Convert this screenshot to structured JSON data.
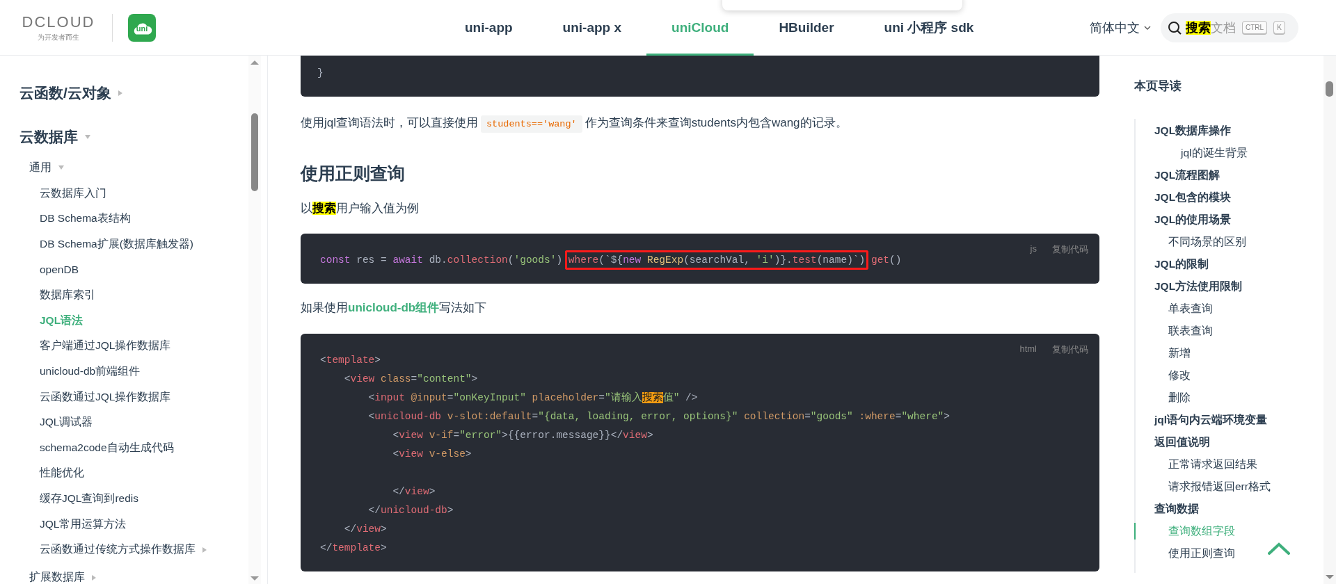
{
  "header": {
    "logo": {
      "wordmark": "DCLOUD",
      "tagline": "为开发者而生",
      "app_badge": "uni"
    },
    "nav": [
      {
        "label": "uni-app",
        "selected": false
      },
      {
        "label": "uni-app x",
        "selected": false
      },
      {
        "label": "uniCloud",
        "selected": true
      },
      {
        "label": "HBuilder",
        "selected": false
      },
      {
        "label": "uni 小程序 sdk",
        "selected": false
      }
    ],
    "language": "简体中文",
    "search": {
      "segments": [
        {
          "text": "搜索",
          "highlighted": true
        },
        {
          "text": "文档",
          "highlighted": false
        }
      ],
      "keys": [
        "CTRL",
        "K"
      ]
    }
  },
  "sidebar": {
    "items": [
      {
        "label": "云函数/云对象",
        "kind": "group",
        "expanded": false,
        "selected": false
      },
      {
        "label": "云数据库",
        "kind": "group",
        "expanded": true,
        "selected": false,
        "children": [
          {
            "label": "通用",
            "kind": "group",
            "expanded": true,
            "selected": false,
            "children": [
              {
                "label": "云数据库入门",
                "kind": "page",
                "selected": false
              },
              {
                "label": "DB Schema表结构",
                "kind": "page",
                "selected": false
              },
              {
                "label": "DB Schema扩展(数据库触发器)",
                "kind": "page",
                "selected": false
              },
              {
                "label": "openDB",
                "kind": "page",
                "selected": false
              },
              {
                "label": "数据库索引",
                "kind": "page",
                "selected": false
              },
              {
                "label": "JQL语法",
                "kind": "page",
                "selected": true
              },
              {
                "label": "客户端通过JQL操作数据库",
                "kind": "page",
                "selected": false
              },
              {
                "label": "unicloud-db前端组件",
                "kind": "page",
                "selected": false
              },
              {
                "label": "云函数通过JQL操作数据库",
                "kind": "page",
                "selected": false
              },
              {
                "label": "JQL调试器",
                "kind": "page",
                "selected": false
              },
              {
                "label": "schema2code自动生成代码",
                "kind": "page",
                "selected": false
              },
              {
                "label": "性能优化",
                "kind": "page",
                "selected": false
              },
              {
                "label": "缓存JQL查询到redis",
                "kind": "page",
                "selected": false
              },
              {
                "label": "JQL常用运算方法",
                "kind": "page",
                "selected": false
              },
              {
                "label": "云函数通过传统方式操作数据库",
                "kind": "group",
                "expanded": false,
                "selected": false
              }
            ]
          },
          {
            "label": "扩展数据库",
            "kind": "group",
            "expanded": false,
            "selected": false
          }
        ]
      }
    ]
  },
  "content": {
    "blocks": [
      {
        "kind": "code",
        "continued": true,
        "lines": [
          {
            "blank_before": false,
            "tokens": [
              {
                "kind": "punct",
                "text": "}"
              }
            ]
          }
        ]
      },
      {
        "kind": "paragraph",
        "segments": [
          {
            "kind": "text",
            "text": "使用jql查询语法时，可以直接使用"
          },
          {
            "kind": "code",
            "text": "students=='wang'"
          },
          {
            "kind": "text",
            "text": "作为查询条件来查询students内包含wang的记录。"
          }
        ]
      },
      {
        "kind": "heading",
        "text": "使用正则查询"
      },
      {
        "kind": "paragraph",
        "segments": [
          {
            "kind": "text",
            "text": "以"
          },
          {
            "kind": "mark",
            "text": "搜索"
          },
          {
            "kind": "text",
            "text": "用户输入值为例"
          }
        ]
      },
      {
        "kind": "code",
        "continued": false,
        "language": "js",
        "copy": "复制代码",
        "lines": [
          {
            "blank_before": false,
            "tokens": [
              {
                "kind": "kw",
                "text": "const",
                "boxed": false
              },
              {
                "kind": "punct",
                "text": " res = ",
                "boxed": false
              },
              {
                "kind": "kw",
                "text": "await",
                "boxed": false
              },
              {
                "kind": "punct",
                "text": " db.",
                "boxed": false
              },
              {
                "kind": "fn",
                "text": "collection",
                "boxed": false
              },
              {
                "kind": "punct",
                "text": "(",
                "boxed": false
              },
              {
                "kind": "str",
                "text": "'goods'",
                "boxed": false
              },
              {
                "kind": "punct",
                "text": ") ",
                "boxed": false
              },
              {
                "kind": "fn",
                "text": "where",
                "boxed": true
              },
              {
                "kind": "punct",
                "text": "(`${",
                "boxed": true
              },
              {
                "kind": "kw",
                "text": "new ",
                "boxed": true
              },
              {
                "kind": "cls",
                "text": "RegExp",
                "boxed": true
              },
              {
                "kind": "punct",
                "text": "(searchVal, ",
                "boxed": true
              },
              {
                "kind": "str",
                "text": "'i'",
                "boxed": true
              },
              {
                "kind": "punct",
                "text": ")}.",
                "boxed": true
              },
              {
                "kind": "fn",
                "text": "test",
                "boxed": true
              },
              {
                "kind": "punct",
                "text": "(name)`)",
                "boxed": true
              },
              {
                "kind": "fn",
                "text": " get",
                "boxed": false
              },
              {
                "kind": "punct",
                "text": "()",
                "boxed": false
              }
            ]
          }
        ]
      },
      {
        "kind": "paragraph",
        "segments": [
          {
            "kind": "text",
            "text": "如果使用"
          },
          {
            "kind": "link",
            "text": "unicloud-db组件"
          },
          {
            "kind": "text",
            "text": "写法如下"
          }
        ]
      },
      {
        "kind": "code",
        "continued": false,
        "language": "html",
        "copy": "复制代码",
        "lines": [
          {
            "blank_before": false,
            "tokens": [
              {
                "kind": "punct",
                "text": "<"
              },
              {
                "kind": "tag",
                "text": "template"
              },
              {
                "kind": "punct",
                "text": ">"
              }
            ]
          },
          {
            "blank_before": false,
            "tokens": [
              {
                "kind": "punct",
                "text": "    <"
              },
              {
                "kind": "tag",
                "text": "view"
              },
              {
                "kind": "attr",
                "text": " class"
              },
              {
                "kind": "punct",
                "text": "="
              },
              {
                "kind": "str",
                "text": "\"content\""
              },
              {
                "kind": "punct",
                "text": ">"
              }
            ]
          },
          {
            "blank_before": false,
            "tokens": [
              {
                "kind": "punct",
                "text": "        <"
              },
              {
                "kind": "tag",
                "text": "input"
              },
              {
                "kind": "attr",
                "text": " @input"
              },
              {
                "kind": "punct",
                "text": "="
              },
              {
                "kind": "str",
                "text": "\"onKeyInput\""
              },
              {
                "kind": "attr",
                "text": " placeholder"
              },
              {
                "kind": "punct",
                "text": "="
              },
              {
                "kind": "str",
                "text": "\"请输入"
              },
              {
                "kind": "mark",
                "text": "搜索"
              },
              {
                "kind": "str",
                "text": "值\""
              },
              {
                "kind": "punct",
                "text": " />"
              }
            ]
          },
          {
            "blank_before": false,
            "tokens": [
              {
                "kind": "punct",
                "text": "        <"
              },
              {
                "kind": "tag",
                "text": "unicloud-db"
              },
              {
                "kind": "attr",
                "text": " v-slot:default"
              },
              {
                "kind": "punct",
                "text": "="
              },
              {
                "kind": "str",
                "text": "\"{data, loading, error, options}\""
              },
              {
                "kind": "attr",
                "text": " collection"
              },
              {
                "kind": "punct",
                "text": "="
              },
              {
                "kind": "str",
                "text": "\"goods\""
              },
              {
                "kind": "attr",
                "text": " :where"
              },
              {
                "kind": "punct",
                "text": "="
              },
              {
                "kind": "str",
                "text": "\"where\""
              },
              {
                "kind": "punct",
                "text": ">"
              }
            ]
          },
          {
            "blank_before": false,
            "tokens": [
              {
                "kind": "punct",
                "text": "            <"
              },
              {
                "kind": "tag",
                "text": "view"
              },
              {
                "kind": "attr",
                "text": " v-if"
              },
              {
                "kind": "punct",
                "text": "="
              },
              {
                "kind": "str",
                "text": "\"error\""
              },
              {
                "kind": "punct",
                "text": ">{{error.message}}</"
              },
              {
                "kind": "tag",
                "text": "view"
              },
              {
                "kind": "punct",
                "text": ">"
              }
            ]
          },
          {
            "blank_before": false,
            "tokens": [
              {
                "kind": "punct",
                "text": "            <"
              },
              {
                "kind": "tag",
                "text": "view"
              },
              {
                "kind": "attr",
                "text": " v-else"
              },
              {
                "kind": "punct",
                "text": ">"
              }
            ]
          },
          {
            "blank_before": true,
            "tokens": [
              {
                "kind": "punct",
                "text": "            </"
              },
              {
                "kind": "tag",
                "text": "view"
              },
              {
                "kind": "punct",
                "text": ">"
              }
            ]
          },
          {
            "blank_before": false,
            "tokens": [
              {
                "kind": "punct",
                "text": "        </"
              },
              {
                "kind": "tag",
                "text": "unicloud-db"
              },
              {
                "kind": "punct",
                "text": ">"
              }
            ]
          },
          {
            "blank_before": false,
            "tokens": [
              {
                "kind": "punct",
                "text": "    </"
              },
              {
                "kind": "tag",
                "text": "view"
              },
              {
                "kind": "punct",
                "text": ">"
              }
            ]
          },
          {
            "blank_before": false,
            "tokens": [
              {
                "kind": "punct",
                "text": "</"
              },
              {
                "kind": "tag",
                "text": "template"
              },
              {
                "kind": "punct",
                "text": ">"
              }
            ]
          }
        ]
      }
    ]
  },
  "toc": {
    "title": "本页导读",
    "items": [
      {
        "label": "JQL数据库操作",
        "selected": false,
        "children": [
          {
            "label": "jql的诞生背景",
            "kind": "h4",
            "selected": false
          }
        ]
      },
      {
        "label": "JQL流程图解",
        "selected": false
      },
      {
        "label": "JQL包含的模块",
        "selected": false
      },
      {
        "label": "JQL的使用场景",
        "selected": false,
        "children": [
          {
            "label": "不同场景的区别",
            "kind": "h3",
            "selected": false
          }
        ]
      },
      {
        "label": "JQL的限制",
        "selected": false
      },
      {
        "label": "JQL方法使用限制",
        "selected": false,
        "children": [
          {
            "label": "单表查询",
            "kind": "h3",
            "selected": false
          },
          {
            "label": "联表查询",
            "kind": "h3",
            "selected": false
          },
          {
            "label": "新增",
            "kind": "h3",
            "selected": false
          },
          {
            "label": "修改",
            "kind": "h3",
            "selected": false
          },
          {
            "label": "删除",
            "kind": "h3",
            "selected": false
          }
        ]
      },
      {
        "label": "jql语句内云端环境变量",
        "selected": false
      },
      {
        "label": "返回值说明",
        "selected": false,
        "children": [
          {
            "label": "正常请求返回结果",
            "kind": "h3",
            "selected": false
          },
          {
            "label": "请求报错返回err格式",
            "kind": "h3",
            "selected": false
          }
        ]
      },
      {
        "label": "查询数据",
        "selected": false,
        "children": [
          {
            "label": "查询数组字段",
            "kind": "h3",
            "selected": true
          },
          {
            "label": "使用正则查询",
            "kind": "h3",
            "selected": false
          }
        ]
      }
    ]
  }
}
